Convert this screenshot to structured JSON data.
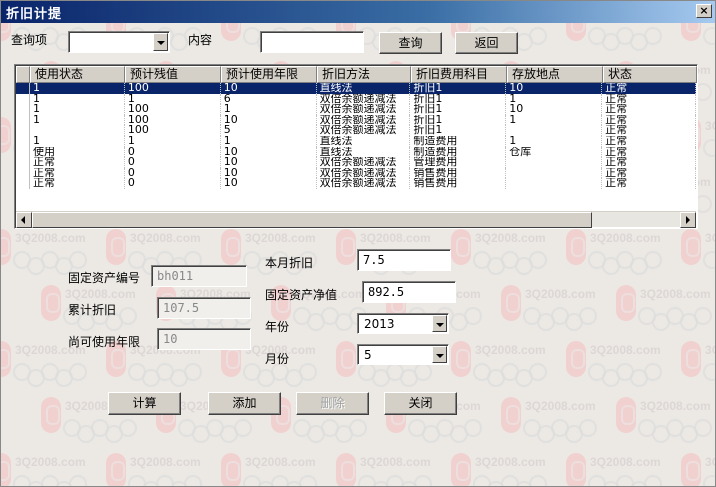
{
  "window": {
    "title": "折旧计提",
    "close_label": "×"
  },
  "watermark": {
    "text": "3Q2008.com"
  },
  "query": {
    "field_label": "查询项",
    "field_value": "",
    "content_label": "内容",
    "content_value": "",
    "search_label": "查询",
    "back_label": "返回"
  },
  "table": {
    "columns": [
      "使用状态",
      "预计残值",
      "预计使用年限",
      "折旧方法",
      "折旧费用科目",
      "存放地点",
      "状态"
    ],
    "rows": [
      [
        "1",
        "100",
        "10",
        "直线法",
        "折旧1",
        "10",
        "正常"
      ],
      [
        "1",
        "1",
        "6",
        "双倍余额递减法",
        "折旧1",
        "1",
        "正常"
      ],
      [
        "1",
        "100",
        "1",
        "双倍余额递减法",
        "折旧1",
        "10",
        "正常"
      ],
      [
        "1",
        "100",
        "10",
        "双倍余额递减法",
        "折旧1",
        "1",
        "正常"
      ],
      [
        "",
        "100",
        "5",
        "双倍余额递减法",
        "折旧1",
        "",
        "正常"
      ],
      [
        "1",
        "1",
        "1",
        "直线法",
        "制造费用",
        "1",
        "正常"
      ],
      [
        "使用",
        "0",
        "10",
        "直线法",
        "制造费用",
        "仓库",
        "正常"
      ],
      [
        "正常",
        "0",
        "10",
        "双倍余额递减法",
        "管理费用",
        "",
        "正常"
      ],
      [
        "正常",
        "0",
        "10",
        "双倍余额递减法",
        "销售费用",
        "",
        "正常"
      ],
      [
        "正常",
        "0",
        "10",
        "双倍余额递减法",
        "销售费用",
        "",
        "正常"
      ]
    ]
  },
  "form": {
    "asset_no_label": "固定资产编号",
    "asset_no_value": "bh011",
    "accum_label": "累计折旧",
    "accum_value": "107.5",
    "remaining_label": "尚可使用年限",
    "remaining_value": "10",
    "month_dep_label": "本月折旧",
    "month_dep_value": "7.5",
    "net_label": "固定资产净值",
    "net_value": "892.5",
    "year_label": "年份",
    "year_value": "2013",
    "month_label": "月份",
    "month_value": "5"
  },
  "buttons": {
    "calc": "计算",
    "add": "添加",
    "delete": "删除",
    "close": "关闭"
  }
}
